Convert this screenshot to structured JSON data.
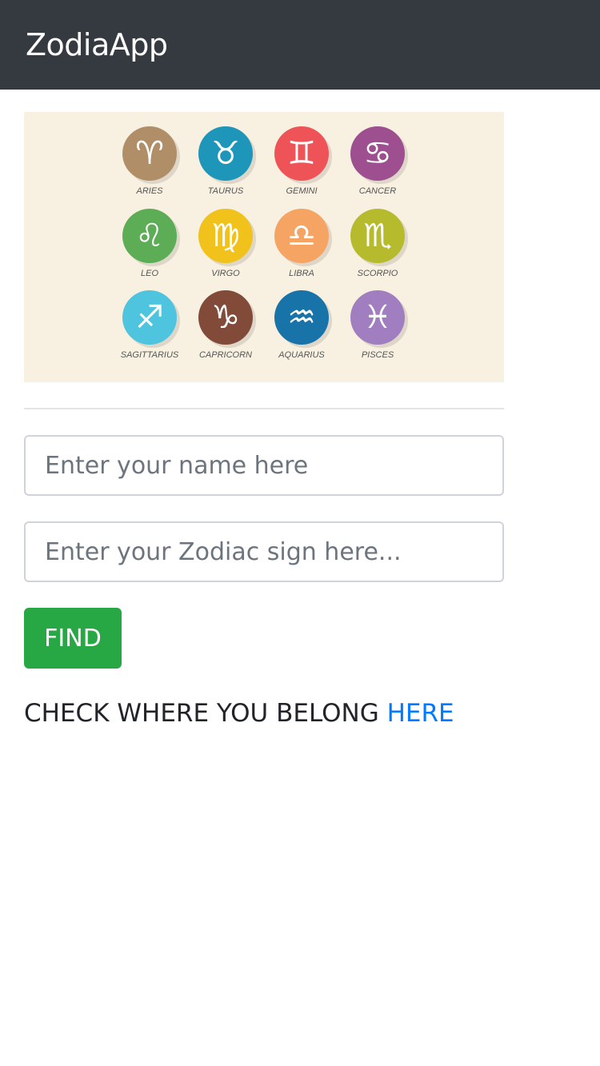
{
  "header": {
    "brand": "ZodiaApp"
  },
  "zodiac_chart": {
    "signs": [
      {
        "name": "ARIES",
        "glyph": "♈",
        "color": "#b08f68",
        "icon": "aries-icon"
      },
      {
        "name": "TAURUS",
        "glyph": "♉",
        "color": "#1d96b9",
        "icon": "taurus-icon"
      },
      {
        "name": "GEMINI",
        "glyph": "♊",
        "color": "#ee5357",
        "icon": "gemini-icon"
      },
      {
        "name": "CANCER",
        "glyph": "♋",
        "color": "#9d4f90",
        "icon": "cancer-icon"
      },
      {
        "name": "LEO",
        "glyph": "♌",
        "color": "#5cad55",
        "icon": "leo-icon"
      },
      {
        "name": "VIRGO",
        "glyph": "♍",
        "color": "#f0c21b",
        "icon": "virgo-icon"
      },
      {
        "name": "LIBRA",
        "glyph": "♎",
        "color": "#f5a463",
        "icon": "libra-icon"
      },
      {
        "name": "SCORPIO",
        "glyph": "♏",
        "color": "#b6ba2d",
        "icon": "scorpio-icon"
      },
      {
        "name": "SAGITTARIUS",
        "glyph": "♐",
        "color": "#4ec4df",
        "icon": "sagittarius-icon"
      },
      {
        "name": "CAPRICORN",
        "glyph": "♑",
        "color": "#814a39",
        "icon": "capricorn-icon"
      },
      {
        "name": "AQUARIUS",
        "glyph": "♒",
        "color": "#1873a8",
        "icon": "aquarius-icon"
      },
      {
        "name": "PISCES",
        "glyph": "♓",
        "color": "#a17ec0",
        "icon": "pisces-icon"
      }
    ]
  },
  "form": {
    "name_placeholder": "Enter your name here",
    "name_value": "",
    "sign_placeholder": "Enter your Zodiac sign here...",
    "sign_value": "",
    "find_label": "FIND"
  },
  "footer": {
    "prompt_text": "CHECK WHERE YOU BELONG ",
    "link_text": "HERE"
  },
  "colors": {
    "navbar": "#343a40",
    "accent_green": "#28a745",
    "link_blue": "#007bff"
  }
}
